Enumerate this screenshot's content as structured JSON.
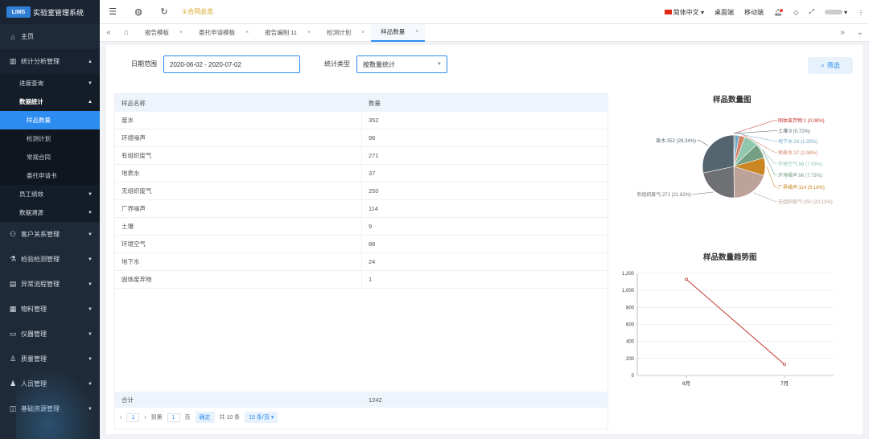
{
  "app": {
    "logo_badge": "LIMS",
    "title": "实验室管理系统"
  },
  "sidebar": {
    "home": "主页",
    "stats_group": "统计分析管理",
    "progress": "进度查询",
    "data_stats": "数据统计",
    "leaves": [
      "样品数量",
      "检测计划",
      "常规合同",
      "委托申请书"
    ],
    "perf": "员工绩效",
    "trace": "数据溯源",
    "groups": [
      "客户关系管理",
      "检验检测管理",
      "异常流程管理",
      "物料管理",
      "仪器管理",
      "质量管理",
      "人员管理",
      "基础资源管理"
    ]
  },
  "topbar": {
    "notice": "①合同总览",
    "lang": "简体中文",
    "desktop": "桌面端",
    "mobile": "移动端"
  },
  "tabs": [
    "报告模板",
    "委托申请模板",
    "报告编制 11",
    "检测计划",
    "样品数量"
  ],
  "filters": {
    "date_label": "日期范围",
    "date_value": "2020-06-02 - 2020-07-02",
    "type_label": "统计类型",
    "type_value": "按数量统计",
    "filter_button": "筛选"
  },
  "table": {
    "headers": [
      "样品名称",
      "数量"
    ],
    "rows": [
      [
        "废水",
        "352"
      ],
      [
        "环境噪声",
        "96"
      ],
      [
        "有组织废气",
        "271"
      ],
      [
        "地表水",
        "37"
      ],
      [
        "无组织废气",
        "250"
      ],
      [
        "厂界噪声",
        "114"
      ],
      [
        "土壤",
        "9"
      ],
      [
        "环境空气",
        "88"
      ],
      [
        "地下水",
        "24"
      ],
      [
        "固体废弃物",
        "1"
      ]
    ],
    "footer_label": "合计",
    "footer_value": "1242"
  },
  "pager": {
    "page": "1",
    "goto": "到第",
    "goto_page": "1",
    "page_unit": "页",
    "confirm": "确定",
    "total": "共 10 条",
    "per_page": "15 条/页"
  },
  "chart_data": [
    {
      "type": "pie",
      "title": "样品数量图",
      "slices": [
        {
          "label": "固体废弃物:1 (0.08%)",
          "value": 1,
          "color": "#c23531"
        },
        {
          "label": "土壤:9 (0.72%)",
          "value": 9,
          "color": "#546570"
        },
        {
          "label": "地下水:24 (1.93%)",
          "value": 24,
          "color": "#6fa8c8"
        },
        {
          "label": "地表水:37 (2.98%)",
          "value": 37,
          "color": "#d48265"
        },
        {
          "label": "环境空气:88 (7.09%)",
          "value": 88,
          "color": "#91c7ae"
        },
        {
          "label": "环境噪声:96 (7.73%)",
          "value": 96,
          "color": "#749f83"
        },
        {
          "label": "厂界噪声:114 (9.18%)",
          "value": 114,
          "color": "#ca8622"
        },
        {
          "label": "无组织废气:250 (20.13%)",
          "value": 250,
          "color": "#bda29a"
        },
        {
          "label": "有组织废气:271 (21.82%)",
          "value": 271,
          "color": "#6e7074"
        },
        {
          "label": "废水:352 (28.34%)",
          "value": 352,
          "color": "#546570"
        }
      ]
    },
    {
      "type": "line",
      "title": "样品数量趋势图",
      "categories": [
        "6月",
        "7月"
      ],
      "values": [
        1130,
        130
      ],
      "ylim": [
        0,
        1200
      ],
      "yticks": [
        "0",
        "200",
        "400",
        "600",
        "800",
        "1,000",
        "1,200"
      ],
      "color": "#c23531"
    }
  ]
}
